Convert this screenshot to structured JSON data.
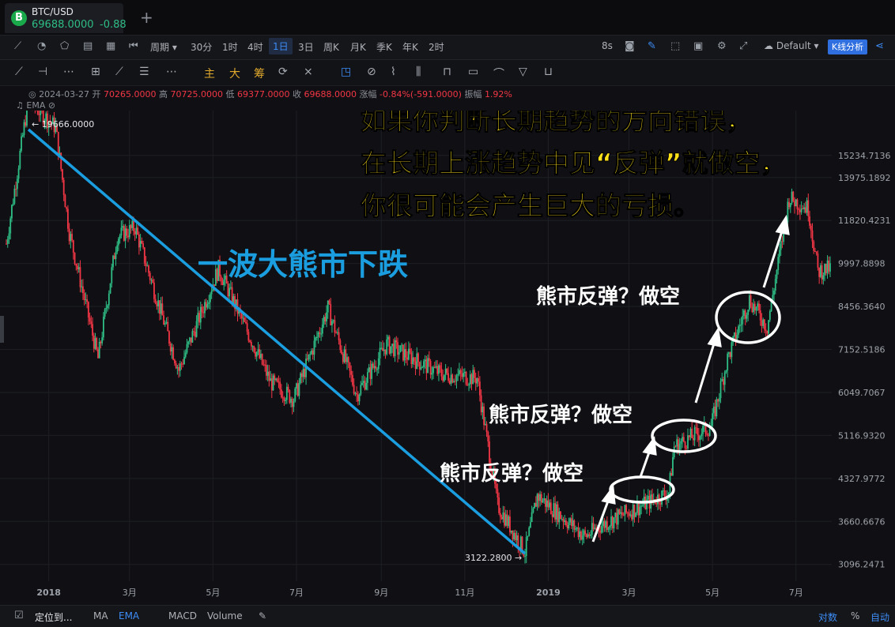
{
  "tab": {
    "symbol": "BTC/USD",
    "price": "69688.0000",
    "change": "-0.88"
  },
  "toolbar": {
    "period_label": "周期",
    "timeframes": [
      "30分",
      "1时",
      "4时",
      "1日",
      "3日",
      "周K",
      "月K",
      "季K",
      "年K",
      "2时"
    ],
    "active_timeframe": "1日",
    "interval": "8s",
    "template": "Default",
    "analysis_button": "K线分析"
  },
  "drawbar": {
    "indicators": [
      "主",
      "大",
      "筹"
    ]
  },
  "info": {
    "date": "2024-03-27",
    "open_label": "开",
    "open": "70265.0000",
    "high_label": "高",
    "high": "70725.0000",
    "low_label": "低",
    "low": "69377.0000",
    "close_label": "收",
    "close": "69688.0000",
    "change_label": "涨幅",
    "change": "-0.84%(-591.0000)",
    "amp_label": "振幅",
    "amp": "1.92%",
    "ema_label": "EMA"
  },
  "annotations": {
    "headline": [
      "如果你判断长期趋势的方向错误，",
      "在长期上涨趋势中见“反弹”就做空，",
      "你很可能会产生巨大的亏损。"
    ],
    "bear_title": "一波大熊市下跌",
    "rebound_label": "熊市反弹？做空",
    "high_marker": "← 19666.0000",
    "low_marker": "3122.2800 →"
  },
  "bottombar": {
    "locate": "定位到...",
    "ma": "MA",
    "ema": "EMA",
    "macd": "MACD",
    "volume": "Volume",
    "log": "对数",
    "percent": "%",
    "auto": "自动"
  },
  "chart_data": {
    "type": "candlestick",
    "symbol": "BTC/USD",
    "y_tick_labels": [
      "15234.7136",
      "13975.1892",
      "11820.4231",
      "9997.8898",
      "8456.3640",
      "7152.5186",
      "6049.7067",
      "5116.9320",
      "4327.9772",
      "3660.6676",
      "3096.2471"
    ],
    "x_tick_labels": [
      "2018",
      "3月",
      "5月",
      "7月",
      "9月",
      "11月",
      "2019",
      "3月",
      "5月",
      "7月"
    ],
    "yscale": "log",
    "ylim": [
      2900,
      17700
    ],
    "highlighted_points": [
      {
        "label": "19666.0000",
        "date": "2017-12-17",
        "value": 19666
      },
      {
        "label": "3122.2800",
        "date": "2018-12-15",
        "value": 3122.28
      }
    ],
    "approx_close_path": [
      {
        "date": "2017-12-01",
        "close": 10800
      },
      {
        "date": "2017-12-17",
        "close": 18900
      },
      {
        "date": "2018-01-06",
        "close": 17000
      },
      {
        "date": "2018-01-16",
        "close": 11300
      },
      {
        "date": "2018-02-06",
        "close": 6900
      },
      {
        "date": "2018-02-20",
        "close": 11100
      },
      {
        "date": "2018-03-05",
        "close": 11500
      },
      {
        "date": "2018-04-06",
        "close": 6600
      },
      {
        "date": "2018-05-05",
        "close": 9800
      },
      {
        "date": "2018-06-12",
        "close": 6300
      },
      {
        "date": "2018-06-29",
        "close": 5900
      },
      {
        "date": "2018-07-24",
        "close": 8400
      },
      {
        "date": "2018-08-14",
        "close": 6000
      },
      {
        "date": "2018-09-05",
        "close": 7300
      },
      {
        "date": "2018-10-15",
        "close": 6500
      },
      {
        "date": "2018-11-10",
        "close": 6400
      },
      {
        "date": "2018-11-25",
        "close": 3900
      },
      {
        "date": "2018-12-15",
        "close": 3250
      },
      {
        "date": "2018-12-24",
        "close": 4050
      },
      {
        "date": "2019-01-28",
        "close": 3450
      },
      {
        "date": "2019-02-08",
        "close": 3600
      },
      {
        "date": "2019-03-30",
        "close": 4100
      },
      {
        "date": "2019-04-03",
        "close": 4900
      },
      {
        "date": "2019-04-30",
        "close": 5300
      },
      {
        "date": "2019-05-12",
        "close": 6900
      },
      {
        "date": "2019-05-28",
        "close": 8700
      },
      {
        "date": "2019-06-10",
        "close": 7800
      },
      {
        "date": "2019-06-26",
        "close": 12900
      },
      {
        "date": "2019-07-10",
        "close": 12400
      },
      {
        "date": "2019-07-17",
        "close": 9700
      },
      {
        "date": "2019-07-26",
        "close": 9800
      }
    ]
  }
}
